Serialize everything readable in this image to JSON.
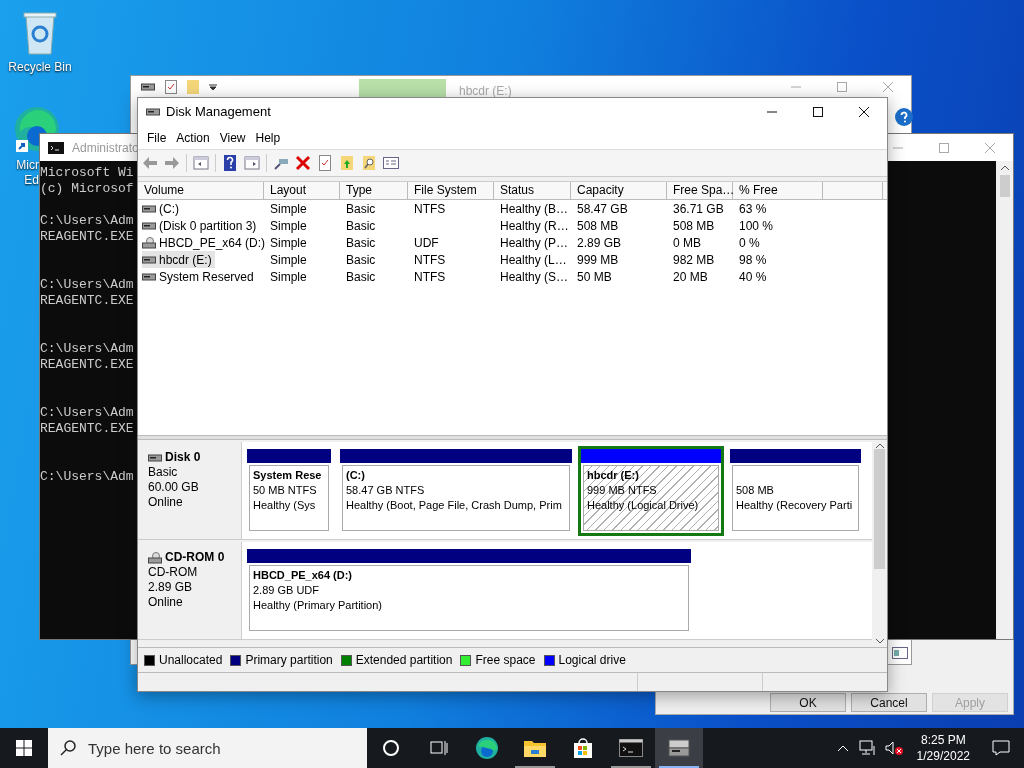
{
  "desktop_icons": [
    {
      "kind": "recycle",
      "label_lines": [
        "Recycle Bin"
      ]
    },
    {
      "kind": "edge",
      "label_lines": [
        "Micr",
        "Ed"
      ]
    }
  ],
  "properties_dialog": {
    "buttons": [
      {
        "label": "OK",
        "disabled": false
      },
      {
        "label": "Cancel",
        "disabled": false
      },
      {
        "label": "Apply",
        "disabled": true
      }
    ]
  },
  "computer_management": {
    "breadcrumb": "hbcdr (E:)"
  },
  "console": {
    "title": "Administrato",
    "blocks": [
      {
        "lines": [
          "Microsoft Wi",
          "(c) Microsof"
        ]
      },
      {
        "lines": [
          "C:\\Users\\Adm",
          "REAGENTC.EXE"
        ]
      },
      {
        "lines": [
          "C:\\Users\\Adm",
          "REAGENTC.EXE"
        ]
      },
      {
        "lines": [
          "C:\\Users\\Adm",
          "REAGENTC.EXE"
        ]
      },
      {
        "lines": [
          "C:\\Users\\Adm",
          "REAGENTC.EXE"
        ]
      },
      {
        "lines": [
          "C:\\Users\\Adm"
        ]
      }
    ]
  },
  "disk_management": {
    "title": "Disk Management",
    "menu": [
      "File",
      "Action",
      "View",
      "Help"
    ],
    "columns": [
      "Volume",
      "Layout",
      "Type",
      "File System",
      "Status",
      "Capacity",
      "Free Spa…",
      "% Free"
    ],
    "rows": [
      {
        "kind": "disk",
        "selected": false,
        "cells": [
          "(C:)",
          "Simple",
          "Basic",
          "NTFS",
          "Healthy (B…",
          "58.47 GB",
          "36.71 GB",
          "63 %"
        ]
      },
      {
        "kind": "disk",
        "selected": false,
        "cells": [
          "(Disk 0 partition 3)",
          "Simple",
          "Basic",
          "",
          "Healthy (R…",
          "508 MB",
          "508 MB",
          "100 %"
        ]
      },
      {
        "kind": "cd",
        "selected": false,
        "cells": [
          "HBCD_PE_x64 (D:)",
          "Simple",
          "Basic",
          "UDF",
          "Healthy (P…",
          "2.89 GB",
          "0 MB",
          "0 %"
        ]
      },
      {
        "kind": "disk",
        "selected": true,
        "cells": [
          "hbcdr (E:)",
          "Simple",
          "Basic",
          "NTFS",
          "Healthy (L…",
          "999 MB",
          "982 MB",
          "98 %"
        ]
      },
      {
        "kind": "disk",
        "selected": false,
        "cells": [
          "System Reserved",
          "Simple",
          "Basic",
          "NTFS",
          "Healthy (S…",
          "50 MB",
          "20 MB",
          "40 %"
        ]
      }
    ],
    "disks": [
      {
        "kind": "disk",
        "name": "Disk 0",
        "lines": [
          "Basic",
          "60.00 GB",
          "Online"
        ],
        "partitions": [
          {
            "kind": "primary",
            "selected": false,
            "title": "System Rese",
            "lines": [
              "50 MB NTFS",
              "Healthy (Sys"
            ]
          },
          {
            "kind": "primary",
            "selected": false,
            "title": "(C:)",
            "lines": [
              "58.47 GB NTFS",
              "Healthy (Boot, Page File, Crash Dump, Prim"
            ]
          },
          {
            "kind": "logical",
            "selected": true,
            "title": "hbcdr  (E:)",
            "lines": [
              "999 MB NTFS",
              "Healthy (Logical Drive)"
            ]
          },
          {
            "kind": "primary",
            "selected": false,
            "lines": [
              "508 MB",
              "Healthy (Recovery Parti"
            ]
          }
        ]
      },
      {
        "kind": "cd",
        "name": "CD-ROM 0",
        "lines": [
          "CD-ROM",
          "2.89 GB",
          "Online"
        ],
        "partitions": [
          {
            "kind": "primary",
            "selected": false,
            "title": "HBCD_PE_x64  (D:)",
            "lines": [
              "2.89 GB UDF",
              "Healthy (Primary Partition)"
            ]
          }
        ]
      }
    ],
    "legend": [
      {
        "label": "Unallocated",
        "color": "#000000"
      },
      {
        "label": "Primary partition",
        "color": "#000080"
      },
      {
        "label": "Extended partition",
        "color": "#008000"
      },
      {
        "label": "Free space",
        "color": "#33ee33"
      },
      {
        "label": "Logical drive",
        "color": "#0000ff"
      }
    ]
  },
  "taskbar": {
    "search_placeholder": "Type here to search",
    "apps": [
      {
        "kind": "cortana",
        "active": false,
        "running": false
      },
      {
        "kind": "task-view",
        "active": false,
        "running": false
      },
      {
        "kind": "edge",
        "active": false,
        "running": false
      },
      {
        "kind": "explorer",
        "active": false,
        "running": true
      },
      {
        "kind": "store",
        "active": false,
        "running": false
      },
      {
        "kind": "terminal",
        "active": false,
        "running": true
      },
      {
        "kind": "disk-tool",
        "active": true,
        "running": true
      }
    ],
    "time": "8:25 PM",
    "date": "1/29/2022"
  }
}
